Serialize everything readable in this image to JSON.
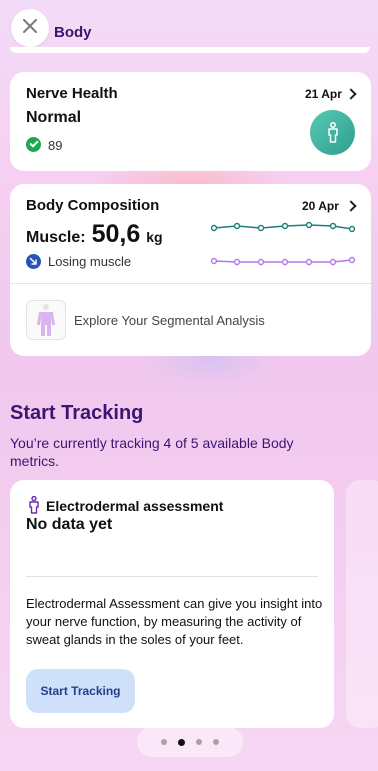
{
  "header": {
    "title": "Body",
    "close_icon": "close-icon"
  },
  "nerve_health": {
    "title": "Nerve Health",
    "date": "21 Apr",
    "status": "Normal",
    "score": "89",
    "icon": "person-icon",
    "icon_color": "#3fb39f"
  },
  "body_composition": {
    "title": "Body Composition",
    "date": "20 Apr",
    "muscle_label": "Muscle:",
    "muscle_value": "50,6",
    "muscle_unit": "kg",
    "trend_text": "Losing muscle",
    "trend_color": "#2854b8",
    "sparkline_colors": [
      "#1f7d7a",
      "#b879e8"
    ],
    "explore_text": "Explore Your Segmental Analysis"
  },
  "start_tracking": {
    "title": "Start Tracking",
    "subtitle": "You’re currently tracking 4 of 5 available Body metrics.",
    "card": {
      "title": "Electrodermal assessment",
      "status": "No data yet",
      "description": "Electrodermal Assessment can give you insight into your nerve function, by measuring the activity of sweat glands in the soles of your feet.",
      "button_label": "Start Tracking"
    }
  },
  "pager": {
    "count": 4,
    "active_index": 1
  },
  "colors": {
    "accent_purple": "#3b1572",
    "button_blue": "#cfe0fb",
    "success_green": "#1fa84f"
  }
}
